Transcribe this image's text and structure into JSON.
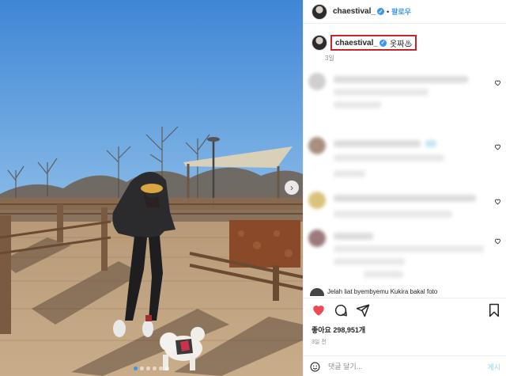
{
  "post": {
    "photo_alt": "",
    "carousel_next": "›",
    "carousel_dots": 6,
    "carousel_active_index": 0
  },
  "header": {
    "username": "chaestival_",
    "verified_mark": "✓",
    "separator": "•",
    "follow_label": "팔로우"
  },
  "caption": {
    "username": "chaestival_",
    "verified_mark": "✓",
    "text": "옷짜♨",
    "time": "3일"
  },
  "comments": {
    "partial_text": "Jelah liat byembyemu Kukira bakal foto"
  },
  "actions": {
    "likes": "좋아요 298,951개",
    "time": "3일 전",
    "icons": [
      "heart-filled-icon",
      "comment-icon",
      "share-icon",
      "bookmark-icon"
    ],
    "like_color": "#ed4956"
  },
  "comment_bar": {
    "placeholder": "댓글 달기...",
    "post_label": "게시"
  }
}
